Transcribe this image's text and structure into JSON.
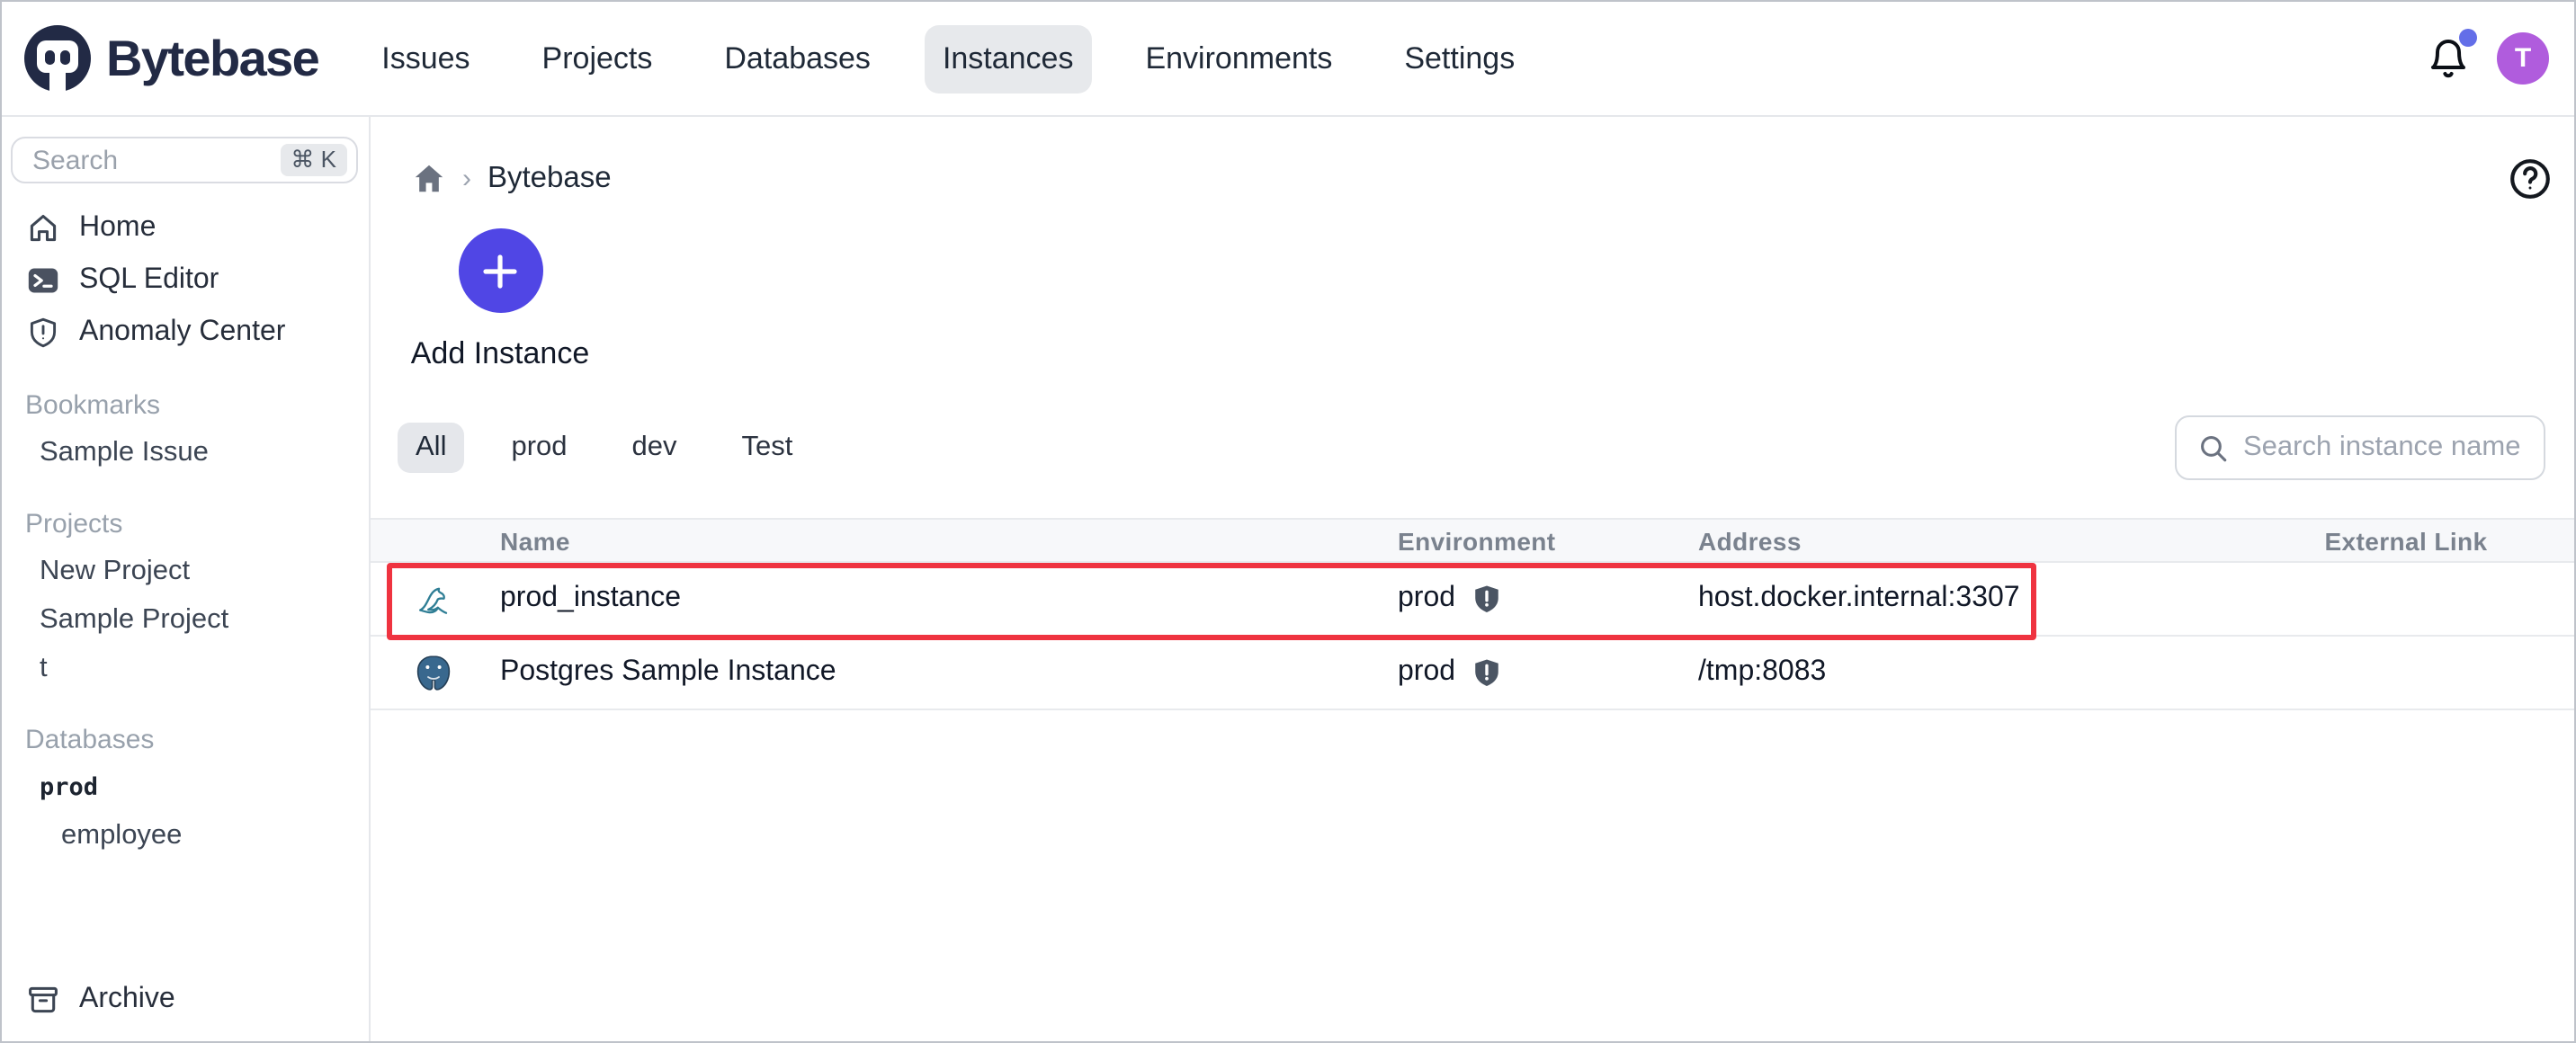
{
  "nav": {
    "logo_text": "Bytebase",
    "items": [
      {
        "label": "Issues",
        "active": false
      },
      {
        "label": "Projects",
        "active": false
      },
      {
        "label": "Databases",
        "active": false
      },
      {
        "label": "Instances",
        "active": true
      },
      {
        "label": "Environments",
        "active": false
      },
      {
        "label": "Settings",
        "active": false
      }
    ],
    "notification": {
      "unread_dot": true
    },
    "avatar_initial": "T"
  },
  "sidebar": {
    "search": {
      "placeholder": "Search",
      "shortcut": "⌘ K"
    },
    "items": [
      {
        "label": "Home",
        "icon": "home-icon"
      },
      {
        "label": "SQL Editor",
        "icon": "terminal-icon"
      },
      {
        "label": "Anomaly Center",
        "icon": "shield-alert-icon"
      }
    ],
    "sections": [
      {
        "title": "Bookmarks",
        "items": [
          "Sample Issue"
        ]
      },
      {
        "title": "Projects",
        "items": [
          "New Project",
          "Sample Project",
          "t"
        ]
      },
      {
        "title": "Databases",
        "items": [
          "prod",
          "employee"
        ]
      }
    ],
    "archive_label": "Archive"
  },
  "main": {
    "breadcrumb": {
      "current": "Bytebase"
    },
    "add_instance_label": "Add Instance",
    "env_tabs": [
      {
        "label": "All",
        "active": true
      },
      {
        "label": "prod",
        "active": false
      },
      {
        "label": "dev",
        "active": false
      },
      {
        "label": "Test",
        "active": false
      }
    ],
    "search_placeholder": "Search instance name",
    "table": {
      "headers": [
        "Name",
        "Environment",
        "Address",
        "External Link"
      ],
      "rows": [
        {
          "engine": "mysql",
          "name": "prod_instance",
          "environment": "prod",
          "address": "host.docker.internal:3307",
          "external_link": "",
          "highlighted": true
        },
        {
          "engine": "postgres",
          "name": "Postgres Sample Instance",
          "environment": "prod",
          "address": "/tmp:8083",
          "external_link": "",
          "highlighted": false
        }
      ]
    }
  },
  "colors": {
    "accent": "#5046e5",
    "avatar_bg": "#b05cdd",
    "notification_dot": "#636ee8",
    "active_chip_bg": "#e7e9ec",
    "highlight_border": "#ef3340",
    "mysql_icon": "#2f7e95",
    "postgres_icon": "#39688e",
    "shield_icon": "#4b5563"
  }
}
